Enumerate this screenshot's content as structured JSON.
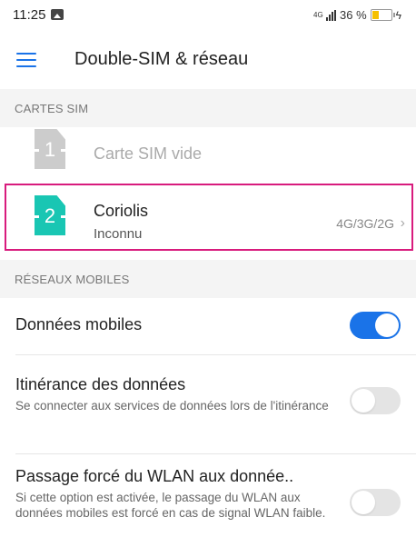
{
  "status_bar": {
    "time": "11:25",
    "network_type": "4G",
    "battery_percent": "36 %",
    "battery_level": 0.36,
    "icons": [
      "image-icon",
      "signal-icon",
      "battery-icon",
      "charging-icon"
    ]
  },
  "header": {
    "title": "Double-SIM & réseau",
    "menu_icon": "hamburger-menu-icon"
  },
  "sim_section": {
    "heading": "CARTES SIM",
    "sims": [
      {
        "slot": "1",
        "title": "Carte SIM vide",
        "subtitle": "",
        "network": "",
        "color": "#cccccc",
        "active": false
      },
      {
        "slot": "2",
        "title": "Coriolis",
        "subtitle": "Inconnu",
        "network": "4G/3G/2G",
        "color": "#19c6b3",
        "active": true
      }
    ]
  },
  "mobile_section": {
    "heading": "RÉSEAUX MOBILES",
    "items": [
      {
        "title": "Données mobiles",
        "description": "",
        "enabled": true
      },
      {
        "title": "Itinérance des données",
        "description": "Se connecter aux services de données lors de l'itinérance",
        "enabled": false
      },
      {
        "title": "Passage forcé du WLAN aux donnée..",
        "description": "Si cette option est activée, le passage du WLAN aux données mobiles est forcé en cas de signal WLAN faible.",
        "enabled": false
      }
    ]
  },
  "colors": {
    "accent": "#1a73e8",
    "sim2": "#19c6b3",
    "sim_empty": "#cccccc",
    "highlight": "#d81b7d",
    "section_bg": "#f4f4f4"
  }
}
